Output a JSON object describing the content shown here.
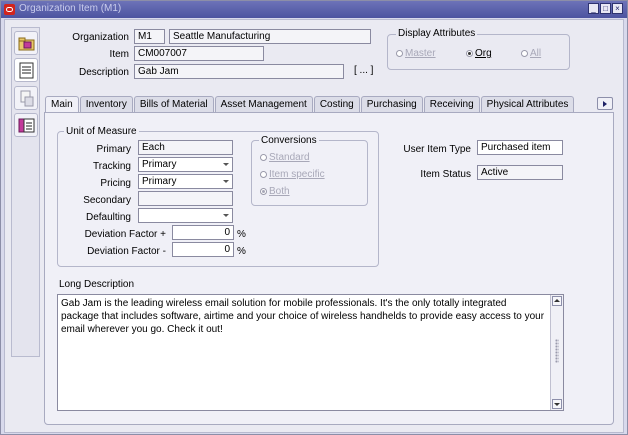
{
  "window": {
    "title": "Organization Item (M1)",
    "buttons": [
      "_",
      "□",
      "×"
    ]
  },
  "header": {
    "organization_label": "Organization",
    "organization_code": "M1",
    "organization_name": "Seattle Manufacturing",
    "item_label": "Item",
    "item_value": "CM007007",
    "description_label": "Description",
    "description_value": "Gab Jam",
    "lov_button": "[ ... ]"
  },
  "display_attributes": {
    "title": "Display Attributes",
    "options": [
      {
        "label": "Master",
        "selected": false,
        "enabled": false
      },
      {
        "label": "Org",
        "selected": true,
        "enabled": true
      },
      {
        "label": "All",
        "selected": false,
        "enabled": false
      }
    ]
  },
  "tabs": [
    {
      "label": "Main",
      "active": true
    },
    {
      "label": "Inventory",
      "active": false
    },
    {
      "label": "Bills of Material",
      "active": false
    },
    {
      "label": "Asset Management",
      "active": false
    },
    {
      "label": "Costing",
      "active": false
    },
    {
      "label": "Purchasing",
      "active": false
    },
    {
      "label": "Receiving",
      "active": false
    },
    {
      "label": "Physical Attributes",
      "active": false
    }
  ],
  "uom": {
    "title": "Unit of Measure",
    "primary_label": "Primary",
    "primary_value": "Each",
    "tracking_label": "Tracking",
    "tracking_value": "Primary",
    "pricing_label": "Pricing",
    "pricing_value": "Primary",
    "secondary_label": "Secondary",
    "secondary_value": "",
    "defaulting_label": "Defaulting",
    "defaulting_value": "",
    "dev_plus_label": "Deviation Factor +",
    "dev_plus_value": "0",
    "dev_minus_label": "Deviation Factor -",
    "dev_minus_value": "0",
    "percent": "%"
  },
  "conversions": {
    "title": "Conversions",
    "options": [
      {
        "label": "Standard",
        "selected": false
      },
      {
        "label": "Item specific",
        "selected": false
      },
      {
        "label": "Both",
        "selected": true
      }
    ]
  },
  "item_info": {
    "user_item_type_label": "User Item Type",
    "user_item_type_value": "Purchased item",
    "item_status_label": "Item Status",
    "item_status_value": "Active"
  },
  "long_description": {
    "label": "Long Description",
    "text": "Gab Jam is the leading wireless email solution for mobile professionals. It's the only totally integrated package that includes software, airtime and your choice of wireless handhelds to provide easy access to your email wherever you go.  Check it out!"
  },
  "toolbar_icons": [
    "folder-icon",
    "list-icon",
    "attachment-icon",
    "bulleted-list-icon"
  ]
}
